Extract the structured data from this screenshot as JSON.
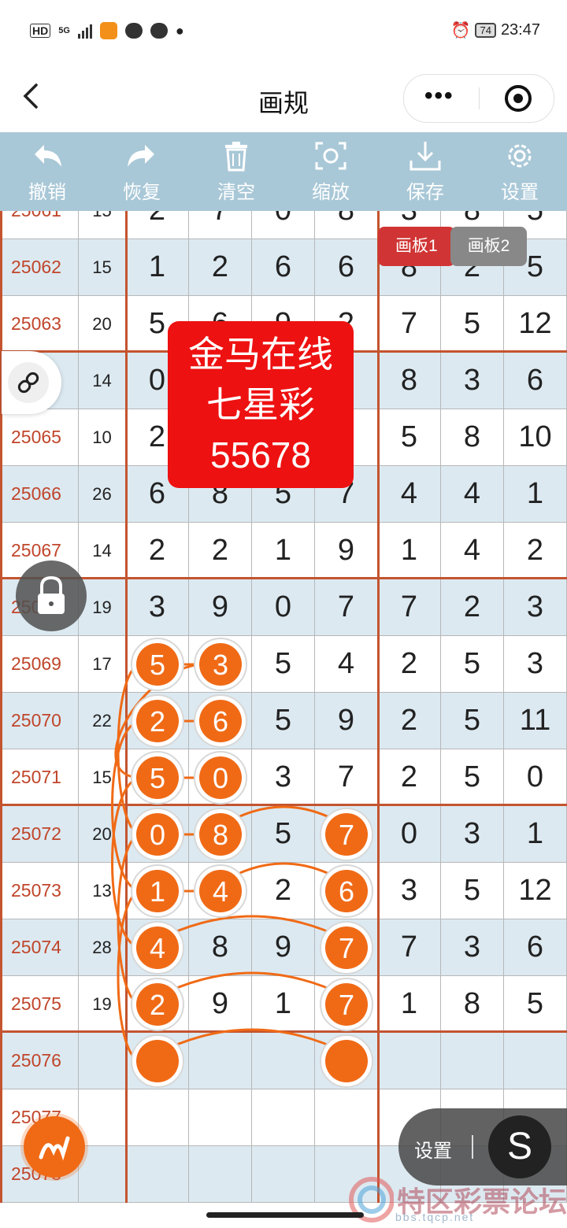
{
  "status_bar": {
    "network": "HD",
    "network_gen": "5G",
    "battery": "74",
    "time": "23:47"
  },
  "nav": {
    "title": "画规",
    "more_label": "•••"
  },
  "toolbar": [
    {
      "id": "undo",
      "icon": "undo-icon",
      "label": "撤销"
    },
    {
      "id": "redo",
      "icon": "redo-icon",
      "label": "恢复"
    },
    {
      "id": "clear",
      "icon": "trash-icon",
      "label": "清空"
    },
    {
      "id": "zoom",
      "icon": "zoom-icon",
      "label": "缩放"
    },
    {
      "id": "save",
      "icon": "save-icon",
      "label": "保存"
    },
    {
      "id": "settings",
      "icon": "gear-icon",
      "label": "设置"
    }
  ],
  "boards": [
    "画板1",
    "画板2"
  ],
  "watermark": [
    "金马在线",
    "七星彩",
    "55678"
  ],
  "rows": [
    {
      "period": "25061",
      "sum": "15",
      "digits": [
        "2",
        "7",
        "0",
        "8",
        "3",
        "8",
        "5"
      ]
    },
    {
      "period": "25062",
      "sum": "15",
      "digits": [
        "1",
        "2",
        "6",
        "6",
        "8",
        "2",
        "5"
      ]
    },
    {
      "period": "25063",
      "sum": "20",
      "digits": [
        "5",
        "6",
        "9",
        "2",
        "7",
        "5",
        "12"
      ]
    },
    {
      "period": "25064",
      "sum": "14",
      "digits": [
        "0",
        "",
        "",
        "",
        "8",
        "3",
        "6"
      ]
    },
    {
      "period": "25065",
      "sum": "10",
      "digits": [
        "2",
        "",
        "",
        "",
        "5",
        "8",
        "10"
      ]
    },
    {
      "period": "25066",
      "sum": "26",
      "digits": [
        "6",
        "8",
        "5",
        "7",
        "4",
        "4",
        "1"
      ]
    },
    {
      "period": "25067",
      "sum": "14",
      "digits": [
        "2",
        "2",
        "1",
        "9",
        "1",
        "4",
        "2"
      ]
    },
    {
      "period": "25068",
      "sum": "19",
      "digits": [
        "3",
        "9",
        "0",
        "7",
        "7",
        "2",
        "3"
      ]
    },
    {
      "period": "25069",
      "sum": "17",
      "digits": [
        "5",
        "3",
        "5",
        "4",
        "2",
        "5",
        "3"
      ]
    },
    {
      "period": "25070",
      "sum": "22",
      "digits": [
        "2",
        "6",
        "5",
        "9",
        "2",
        "5",
        "11"
      ]
    },
    {
      "period": "25071",
      "sum": "15",
      "digits": [
        "5",
        "0",
        "3",
        "7",
        "2",
        "5",
        "0"
      ]
    },
    {
      "period": "25072",
      "sum": "20",
      "digits": [
        "0",
        "8",
        "5",
        "7",
        "0",
        "3",
        "1"
      ]
    },
    {
      "period": "25073",
      "sum": "13",
      "digits": [
        "1",
        "4",
        "2",
        "6",
        "3",
        "5",
        "12"
      ]
    },
    {
      "period": "25074",
      "sum": "28",
      "digits": [
        "4",
        "8",
        "9",
        "7",
        "7",
        "3",
        "6"
      ]
    },
    {
      "period": "25075",
      "sum": "19",
      "digits": [
        "2",
        "9",
        "1",
        "7",
        "1",
        "8",
        "5"
      ]
    },
    {
      "period": "25076",
      "sum": "",
      "digits": [
        "",
        "",
        "",
        "",
        "",
        "",
        ""
      ]
    },
    {
      "period": "25077",
      "sum": "",
      "digits": [
        "",
        "",
        "",
        "",
        "",
        "",
        ""
      ]
    },
    {
      "period": "25078",
      "sum": "",
      "digits": [
        "",
        "",
        "",
        "",
        "",
        "",
        ""
      ]
    }
  ],
  "marks": [
    {
      "row": 8,
      "col": 0,
      "value": "5"
    },
    {
      "row": 8,
      "col": 1,
      "value": "3"
    },
    {
      "row": 9,
      "col": 0,
      "value": "2"
    },
    {
      "row": 9,
      "col": 1,
      "value": "6"
    },
    {
      "row": 10,
      "col": 0,
      "value": "5"
    },
    {
      "row": 10,
      "col": 1,
      "value": "0"
    },
    {
      "row": 11,
      "col": 0,
      "value": "0"
    },
    {
      "row": 11,
      "col": 1,
      "value": "8"
    },
    {
      "row": 11,
      "col": 3,
      "value": "7"
    },
    {
      "row": 12,
      "col": 0,
      "value": "1"
    },
    {
      "row": 12,
      "col": 1,
      "value": "4"
    },
    {
      "row": 12,
      "col": 3,
      "value": "6"
    },
    {
      "row": 13,
      "col": 0,
      "value": "4"
    },
    {
      "row": 13,
      "col": 3,
      "value": "7"
    },
    {
      "row": 14,
      "col": 0,
      "value": "2"
    },
    {
      "row": 14,
      "col": 3,
      "value": "7"
    },
    {
      "row": 15,
      "col": 0,
      "value": ""
    },
    {
      "row": 15,
      "col": 3,
      "value": ""
    }
  ],
  "float_panel": {
    "settings_label": "设置",
    "s_label": "S"
  },
  "footer_logo": {
    "text": "特区彩票论坛",
    "url": "bbs.tqcp.net"
  },
  "colors": {
    "toolbar": "#a9c8d7",
    "accent_line": "#c3542f",
    "ball": "#f06a16",
    "period_text": "#c0452a",
    "row_alt": "#dce9f1"
  }
}
